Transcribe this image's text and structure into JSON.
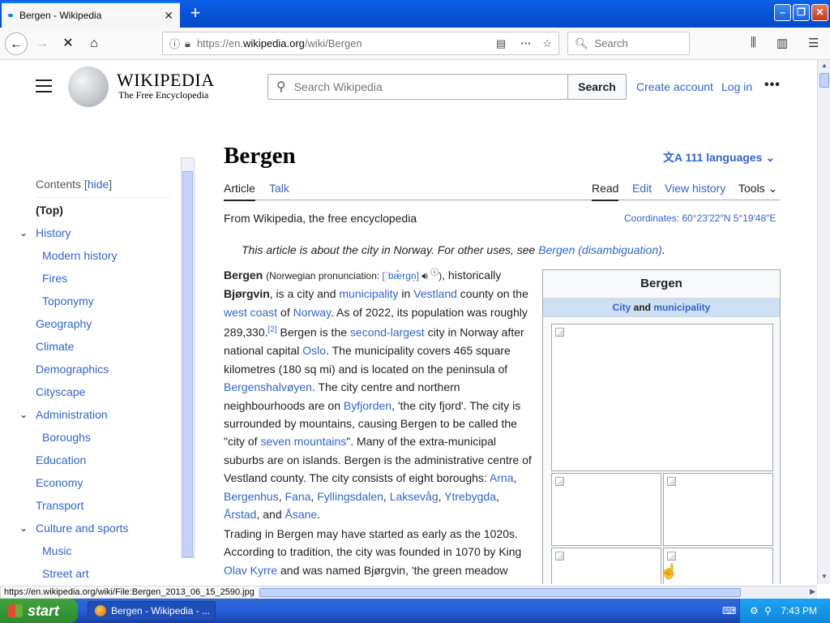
{
  "browser": {
    "tab_title": "Bergen - Wikipedia",
    "url_prefix": "https://en.",
    "url_host": "wikipedia.org",
    "url_path": "/wiki/Bergen",
    "search_placeholder": "Search",
    "status_url": "https://en.wikipedia.org/wiki/File:Bergen_2013_06_15_2590.jpg"
  },
  "wiki_header": {
    "wordmark": "WIKIPEDIA",
    "tagline": "The Free Encyclopedia",
    "search_placeholder": "Search Wikipedia",
    "search_button": "Search",
    "create_account": "Create account",
    "log_in": "Log in"
  },
  "toc": {
    "title": "Contents",
    "hide": "hide",
    "items": [
      {
        "label": "(Top)"
      },
      {
        "label": "History"
      },
      {
        "label": "Modern history"
      },
      {
        "label": "Fires"
      },
      {
        "label": "Toponymy"
      },
      {
        "label": "Geography"
      },
      {
        "label": "Climate"
      },
      {
        "label": "Demographics"
      },
      {
        "label": "Cityscape"
      },
      {
        "label": "Administration"
      },
      {
        "label": "Boroughs"
      },
      {
        "label": "Education"
      },
      {
        "label": "Economy"
      },
      {
        "label": "Transport"
      },
      {
        "label": "Culture and sports"
      },
      {
        "label": "Music"
      },
      {
        "label": "Street art"
      }
    ]
  },
  "article": {
    "title": "Bergen",
    "languages": "111 languages",
    "tabs": {
      "article": "Article",
      "talk": "Talk",
      "read": "Read",
      "edit": "Edit",
      "view_history": "View history",
      "tools": "Tools"
    },
    "from": "From Wikipedia, the free encyclopedia",
    "coordinates": "Coordinates: 60°23′22″N 5°19′48″E",
    "hatnote_text": "This article is about the city in Norway. For other uses, see ",
    "hatnote_link": "Bergen (disambiguation)",
    "hatnote_end": "."
  },
  "infobox": {
    "title": "Bergen",
    "sub_city": "City",
    "sub_and": " and ",
    "sub_municipality": "municipality"
  },
  "taskbar": {
    "start": "start",
    "task_label": "Bergen - Wikipedia - ...",
    "clock": "7:43 PM"
  }
}
